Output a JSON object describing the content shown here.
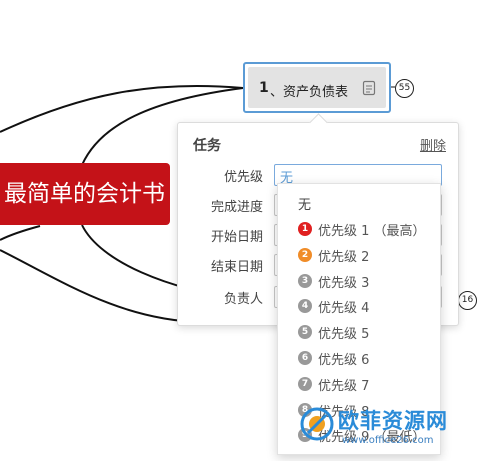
{
  "mindmap": {
    "central_topic": "最简单的会计书",
    "selected_node": {
      "number": "1",
      "label": "、资产负债表",
      "note_icon": "note-icon",
      "count": "55"
    },
    "second_count": "16"
  },
  "task_panel": {
    "title": "任务",
    "delete_label": "删除",
    "fields": [
      {
        "label": "优先级",
        "value": "无"
      },
      {
        "label": "完成进度",
        "value": ""
      },
      {
        "label": "开始日期",
        "value": ""
      },
      {
        "label": "结束日期",
        "value": ""
      },
      {
        "label": "负责人",
        "value": ""
      }
    ]
  },
  "priority_dropdown": {
    "none_label": "无",
    "options": [
      {
        "badge": "1",
        "label": "优先级 1 （最高）",
        "color": "#e02020"
      },
      {
        "badge": "2",
        "label": "优先级 2",
        "color": "#f08c28"
      },
      {
        "badge": "3",
        "label": "优先级 3",
        "color": "#999999"
      },
      {
        "badge": "4",
        "label": "优先级 4",
        "color": "#999999"
      },
      {
        "badge": "5",
        "label": "优先级 5",
        "color": "#999999"
      },
      {
        "badge": "6",
        "label": "优先级 6",
        "color": "#999999"
      },
      {
        "badge": "7",
        "label": "优先级 7",
        "color": "#999999"
      },
      {
        "badge": "8",
        "label": "优先级 8",
        "color": "#999999"
      },
      {
        "badge": "9",
        "label": "优先级 9 （最低）",
        "color": "#999999"
      }
    ]
  },
  "watermark": {
    "title": "欧菲资源网",
    "url": "www.office26.com"
  }
}
